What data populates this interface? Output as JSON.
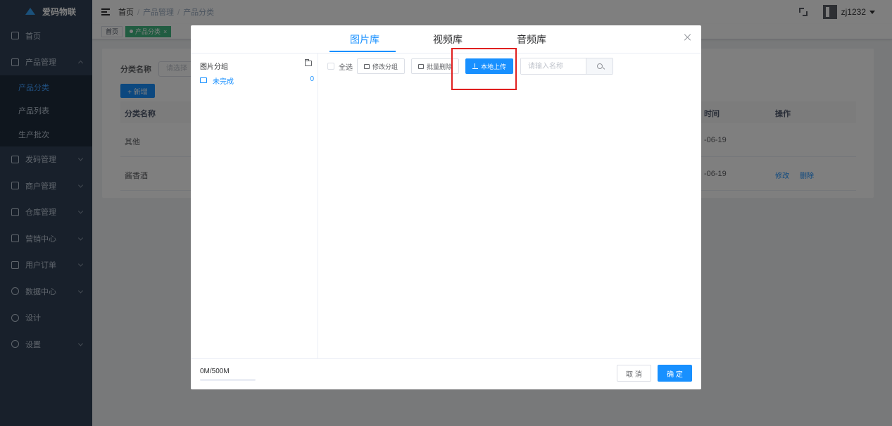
{
  "sidebar": {
    "logo": "爱码物联",
    "items": [
      {
        "label": "首页",
        "icon": "home-icon"
      },
      {
        "label": "产品管理",
        "icon": "product-icon"
      },
      {
        "label": "发码管理",
        "icon": "code-icon"
      },
      {
        "label": "商户管理",
        "icon": "merchant-icon"
      },
      {
        "label": "仓库管理",
        "icon": "warehouse-icon"
      },
      {
        "label": "营销中心",
        "icon": "gift-icon"
      },
      {
        "label": "用户订单",
        "icon": "order-icon"
      },
      {
        "label": "数据中心",
        "icon": "clock-icon"
      },
      {
        "label": "设计",
        "icon": "design-icon"
      },
      {
        "label": "设置",
        "icon": "settings-icon"
      }
    ],
    "submenu": [
      "产品分类",
      "产品列表",
      "生产批次"
    ]
  },
  "navbar": {
    "breadcrumb": [
      "首页",
      "产品管理",
      "产品分类"
    ],
    "separator": "/",
    "username": "zj1232"
  },
  "tags": {
    "home": "首页",
    "active": "产品分类",
    "close": "×"
  },
  "page": {
    "filter_label": "分类名称",
    "filter_placeholder": "请选择",
    "add_button": "+ 新增",
    "columns": [
      "分类名称",
      "时间",
      "操作"
    ],
    "rows": [
      {
        "name": "其他",
        "date": "-06-19",
        "edit": "",
        "delete": ""
      },
      {
        "name": "酱香酒",
        "date": "-06-19",
        "edit": "修改",
        "delete": "删除"
      }
    ]
  },
  "dialog": {
    "tabs": [
      "图片库",
      "视频库",
      "音频库"
    ],
    "left_title": "图片分组",
    "group": {
      "label": "未完成",
      "count": "0"
    },
    "select_all": "全选",
    "edit_group": "修改分组",
    "batch_delete": "批量删除",
    "upload": "本地上传",
    "search_placeholder": "请输入名称",
    "storage": "0M/500M",
    "storage_fraction": 0,
    "cancel": "取 消",
    "ok": "确 定",
    "accent": "#1890ff",
    "highlight_color": "#e02020"
  }
}
